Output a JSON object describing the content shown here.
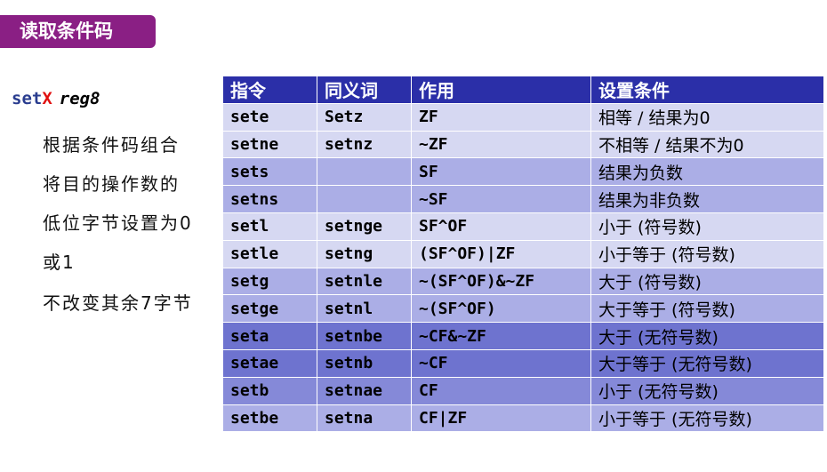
{
  "title": "读取条件码",
  "setx": {
    "prefix": "set",
    "x": "X",
    "reg": "reg8"
  },
  "description": [
    "根据条件码组合",
    "将目的操作数的",
    "低位字节设置为0",
    "或1",
    "不改变其余7字节"
  ],
  "table": {
    "headers": [
      "指令",
      "同义词",
      "作用",
      "设置条件"
    ],
    "rows": [
      {
        "instr": "sete",
        "syn": "Setz",
        "effect": "ZF",
        "cond": "相等 / 结果为0"
      },
      {
        "instr": "setne",
        "syn": "setnz",
        "effect": "~ZF",
        "cond": "不相等 / 结果不为0"
      },
      {
        "instr": "sets",
        "syn": "",
        "effect": "SF",
        "cond": "结果为负数"
      },
      {
        "instr": "setns",
        "syn": "",
        "effect": "~SF",
        "cond": "结果为非负数"
      },
      {
        "instr": "setl",
        "syn": "setnge",
        "effect": "SF^OF",
        "cond": "小于 (符号数)"
      },
      {
        "instr": "setle",
        "syn": "setng",
        "effect": "(SF^OF)|ZF",
        "cond": "小于等于 (符号数)"
      },
      {
        "instr": "setg",
        "syn": "setnle",
        "effect": "~(SF^OF)&~ZF",
        "cond": "大于 (符号数)"
      },
      {
        "instr": "setge",
        "syn": "setnl",
        "effect": "~(SF^OF)",
        "cond": "大于等于 (符号数)"
      },
      {
        "instr": "seta",
        "syn": "setnbe",
        "effect": "~CF&~ZF",
        "cond": "大于 (无符号数)"
      },
      {
        "instr": "setae",
        "syn": "setnb",
        "effect": "~CF",
        "cond": "大于等于 (无符号数)"
      },
      {
        "instr": "setb",
        "syn": "setnae",
        "effect": "CF",
        "cond": "小于 (无符号数)"
      },
      {
        "instr": "setbe",
        "syn": "setna",
        "effect": "CF|ZF",
        "cond": "小于等于 (无符号数)"
      }
    ]
  }
}
